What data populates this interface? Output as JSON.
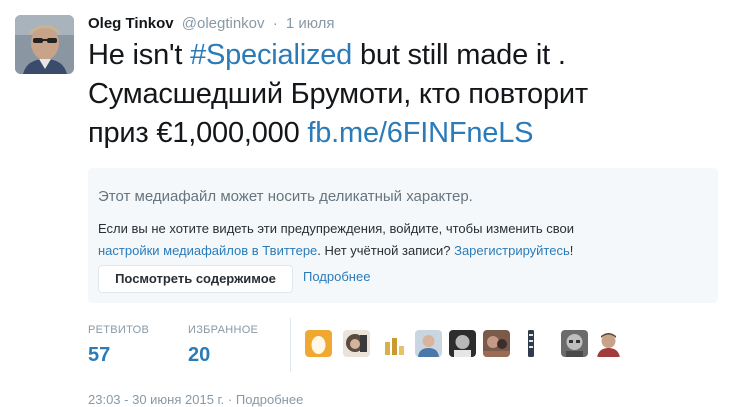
{
  "tweet": {
    "author_name": "Oleg Tinkov",
    "handle": "@olegtinkov",
    "separator": "·",
    "date": "1 июля",
    "text_line1_a": "He isn't ",
    "text_line1_hashtag": "#Specialized",
    "text_line1_b": " but still made it .",
    "text_line2": "Сумасшедший Брумоти, кто повторит",
    "text_line3_a": "приз €1,000,000 ",
    "text_line3_link": "fb.me/6FINFneLS"
  },
  "media_warning": {
    "title": "Этот медиафайл может носить деликатный характер.",
    "body_line1": "Если вы не хотите видеть эти предупреждения, войдите, чтобы изменить свои",
    "settings_link": "настройки медиафайлов в Твиттере",
    "body_mid": ". Нет учётной записи? ",
    "register_link": "Зарегистрируйтесь",
    "body_end": "!",
    "show_button": "Посмотреть содержимое",
    "learn_more": "Подробнее"
  },
  "stats": {
    "retweets_label": "РЕТВИТОВ",
    "retweets_value": "57",
    "favorites_label": "ИЗБРАННОЕ",
    "favorites_value": "20"
  },
  "footer": {
    "timestamp": "23:03 - 30 июня 2015 г.",
    "separator": "·",
    "details": "Подробнее"
  },
  "colors": {
    "link": "#2b7bb9",
    "muted": "#8899a6",
    "warning_bg": "#f5f8fa"
  }
}
